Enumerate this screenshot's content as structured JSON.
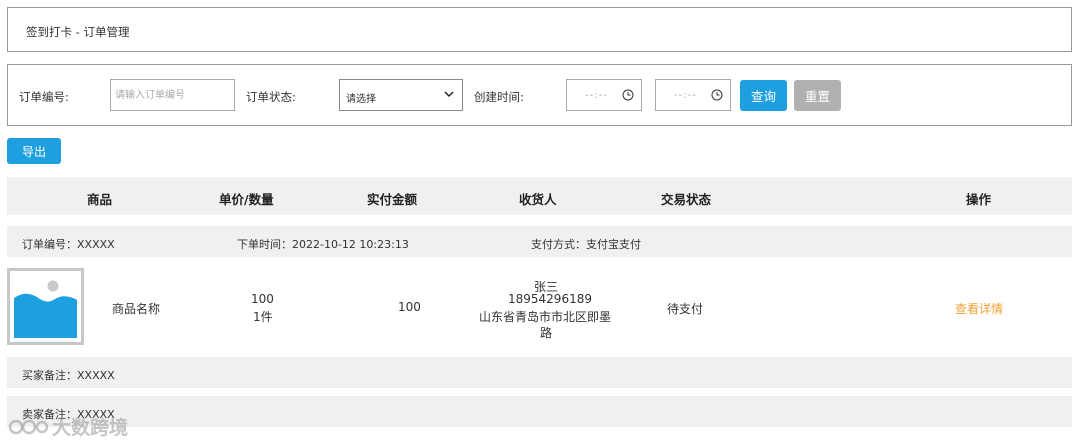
{
  "page": {
    "title": "签到打卡 - 订单管理"
  },
  "filters": {
    "order_no_label": "订单编号:",
    "order_no_placeholder": "请输入订单编号",
    "status_label": "订单状态:",
    "status_selected": "请选择",
    "created_label": "创建时间:",
    "date_placeholder": "--:--",
    "query_label": "查询",
    "reset_label": "重置"
  },
  "export_label": "导出",
  "table": {
    "headers": [
      "商品",
      "单价/数量",
      "实付金额",
      "收货人",
      "交易状态",
      "操作"
    ]
  },
  "order": {
    "order_no": "订单编号：XXXXX",
    "order_time": "下单时间：2022-10-12 10:23:13",
    "payment": "支付方式：支付宝支付",
    "product_name": "商品名称",
    "unit_price": "100",
    "quantity": "1件",
    "paid_amount": "100",
    "receiver_name": "张三",
    "receiver_phone": "18954296189",
    "receiver_address_1": "山东省青岛市市北区即墨",
    "receiver_address_2": "路",
    "trade_status": "待支付",
    "action": "查看详情",
    "buyer_note": "买家备注：XXXXX",
    "seller_note": "卖家备注：XXXXX"
  },
  "watermark": "大数跨境",
  "colors": {
    "accent": "#1e9fe0",
    "link": "#f0a030",
    "muted_button": "#b0b0b0"
  }
}
